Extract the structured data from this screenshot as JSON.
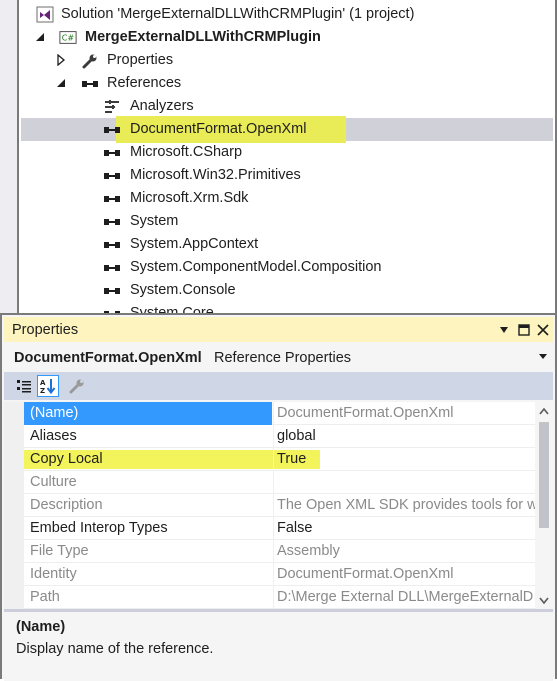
{
  "solution_explorer": {
    "rows": [
      {
        "label": "Solution 'MergeExternalDLLWithCRMPlugin' (1 project)",
        "icon": "solution-icon",
        "expander": "none",
        "bold": false
      },
      {
        "label": "MergeExternalDLLWithCRMPlugin",
        "icon": "csharp-project-icon",
        "expander": "expanded",
        "bold": true
      },
      {
        "label": "Properties",
        "icon": "wrench-icon",
        "expander": "collapsed",
        "bold": false
      },
      {
        "label": "References",
        "icon": "references-icon",
        "expander": "expanded",
        "bold": false
      },
      {
        "label": "Analyzers",
        "icon": "analyzers-icon",
        "expander": "none",
        "bold": false
      },
      {
        "label": "DocumentFormat.OpenXml",
        "icon": "reference-icon",
        "expander": "none",
        "bold": false,
        "selected": true
      },
      {
        "label": "Microsoft.CSharp",
        "icon": "reference-icon",
        "expander": "none",
        "bold": false
      },
      {
        "label": "Microsoft.Win32.Primitives",
        "icon": "reference-icon",
        "expander": "none",
        "bold": false
      },
      {
        "label": "Microsoft.Xrm.Sdk",
        "icon": "reference-icon",
        "expander": "none",
        "bold": false
      },
      {
        "label": "System",
        "icon": "reference-icon",
        "expander": "none",
        "bold": false
      },
      {
        "label": "System.AppContext",
        "icon": "reference-icon",
        "expander": "none",
        "bold": false
      },
      {
        "label": "System.ComponentModel.Composition",
        "icon": "reference-icon",
        "expander": "none",
        "bold": false
      },
      {
        "label": "System.Console",
        "icon": "reference-icon",
        "expander": "none",
        "bold": false
      },
      {
        "label": "System.Core",
        "icon": "reference-icon",
        "expander": "none",
        "bold": false
      }
    ]
  },
  "properties_window": {
    "title": "Properties",
    "title_buttons": [
      "dropdown-arrow-icon",
      "maximize-icon",
      "close-icon"
    ],
    "object_name": "DocumentFormat.OpenXml",
    "object_type": "Reference Properties",
    "toolbar": [
      "categorized-icon",
      "alphabetical-icon",
      "property-pages-wrench-icon"
    ],
    "properties": [
      {
        "name": "(Name)",
        "value": "DocumentFormat.OpenXml",
        "readonly": true,
        "selected": true
      },
      {
        "name": "Aliases",
        "value": "global",
        "readonly": false
      },
      {
        "name": "Copy Local",
        "value": "True",
        "readonly": false,
        "highlighted": true
      },
      {
        "name": "Culture",
        "value": "",
        "readonly": true
      },
      {
        "name": "Description",
        "value": "The Open XML SDK provides tools for w",
        "readonly": true
      },
      {
        "name": "Embed Interop Types",
        "value": "False",
        "readonly": false
      },
      {
        "name": "File Type",
        "value": "Assembly",
        "readonly": true
      },
      {
        "name": "Identity",
        "value": "DocumentFormat.OpenXml",
        "readonly": true
      },
      {
        "name": "Path",
        "value": "D:\\Merge External DLL\\MergeExternalD",
        "readonly": true
      }
    ],
    "description_title": "(Name)",
    "description_text": "Display name of the reference."
  },
  "colors": {
    "selection_row": "#cfd0d8",
    "highlighter": "#e9ec56",
    "title_bar": "#fdf4bf",
    "grid_selection": "#3399ff"
  }
}
